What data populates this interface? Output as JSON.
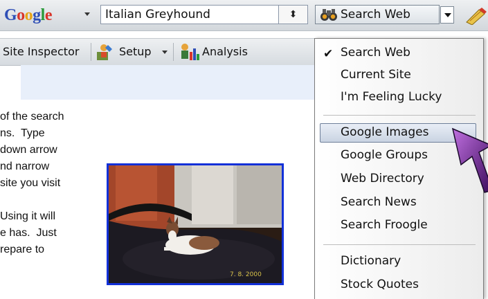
{
  "toolbar": {
    "logo": [
      "G",
      "o",
      "o",
      "g",
      "l",
      "e"
    ],
    "search_value": "Italian Greyhound",
    "spin_glyph": "⬍",
    "search_web_label": "Search Web"
  },
  "toolbar2": {
    "site_inspector": "Site Inspector",
    "setup": "Setup",
    "analysis": "Analysis"
  },
  "article_lines": [
    "of the search",
    "ns.  Type",
    "down arrow",
    "nd narrow",
    "site you visit",
    "",
    "Using it will",
    "e has.  Just",
    "repare to"
  ],
  "photo": {
    "date_stamp": "7. 8. 2000"
  },
  "menu": {
    "check": "✔",
    "items": [
      "Search Web",
      "Current Site",
      "I'm Feeling Lucky",
      "Google Images",
      "Google Groups",
      "Web Directory",
      "Search News",
      "Search Froogle",
      "Dictionary",
      "Stock Quotes"
    ]
  }
}
